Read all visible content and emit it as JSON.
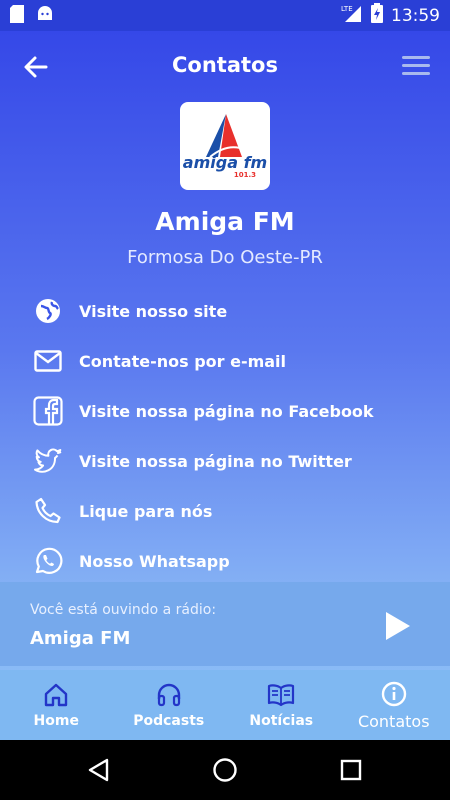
{
  "status_bar": {
    "time": "13:59",
    "network": "LTE",
    "icons": [
      "sd-card-icon",
      "android-icon",
      "signal-icon",
      "battery-icon"
    ]
  },
  "header": {
    "title": "Contatos",
    "back_icon": "arrow-left-icon",
    "menu_icon": "hamburger-menu-icon"
  },
  "logo": {
    "brand_text": "amiga fm",
    "frequency": "101.3"
  },
  "station": {
    "name": "Amiga FM",
    "location": "Formosa Do Oeste-PR"
  },
  "contacts": [
    {
      "icon": "globe-icon",
      "label": "Visite nosso site"
    },
    {
      "icon": "email-icon",
      "label": "Contate-nos por e-mail"
    },
    {
      "icon": "facebook-icon",
      "label": "Visite nossa página no Facebook"
    },
    {
      "icon": "twitter-icon",
      "label": "Visite nossa página no Twitter"
    },
    {
      "icon": "phone-icon",
      "label": "Lique para nós"
    },
    {
      "icon": "whatsapp-icon",
      "label": "Nosso Whatsapp"
    }
  ],
  "player": {
    "caption": "Você está ouvindo a rádio:",
    "station": "Amiga FM",
    "play_icon": "play-icon"
  },
  "bottom_nav": [
    {
      "icon": "home-icon",
      "label": "Home"
    },
    {
      "icon": "headphones-icon",
      "label": "Podcasts"
    },
    {
      "icon": "book-icon",
      "label": "Notícias"
    },
    {
      "icon": "info-icon",
      "label": "Contatos",
      "active": true
    }
  ],
  "colors": {
    "gradient_top": "#3548e8",
    "gradient_bottom": "#8dc2f6",
    "player_bar": "#76a9ec",
    "bottom_nav": "#7fb8f2",
    "logo_red": "#e8302c",
    "logo_blue": "#1b4fa8"
  }
}
